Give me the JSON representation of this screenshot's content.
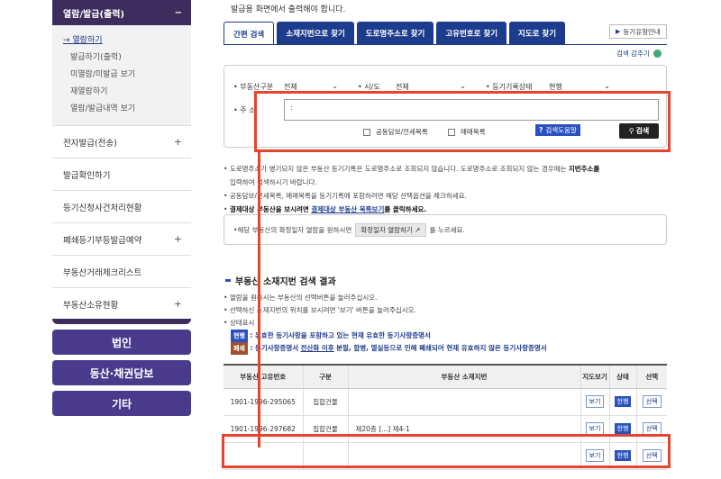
{
  "sidebar": {
    "header": "열람/발급(출력)",
    "header_icon": "minus-icon",
    "sub_items": [
      {
        "label": "열람하기",
        "active": true
      },
      {
        "label": "발급하기(출력)",
        "active": false
      },
      {
        "label": "미열람/미발급 보기",
        "active": false
      },
      {
        "label": "재열람하기",
        "active": false
      },
      {
        "label": "열람/발급내역 보기",
        "active": false
      }
    ],
    "items": [
      {
        "label": "전자발급(전송)",
        "plus": true
      },
      {
        "label": "발급확인하기",
        "plus": false
      },
      {
        "label": "등기신청사건처리현황",
        "plus": false
      },
      {
        "label": "폐쇄등기부등발급예약",
        "plus": true
      },
      {
        "label": "부동산거래체크리스트",
        "plus": false
      },
      {
        "label": "부동산소유현황",
        "plus": true
      }
    ],
    "plus_symbol": "+",
    "buttons": [
      "법인",
      "동산·채권담보",
      "기타"
    ]
  },
  "main": {
    "top_note": "발급용 화면에서 출력해야 합니다.",
    "tabs": [
      "간편 검색",
      "소재지번으로 찾기",
      "도로명주소로 찾기",
      "고유번호로 찾기",
      "지도로 찾기"
    ],
    "guide_button": "등기유형안내",
    "search_toggle": "검색 감추기",
    "search": {
      "type_label": "부동산구분",
      "type_value": "전체",
      "region_label": "시/도",
      "region_value": "전체",
      "status_label": "등기기록상태",
      "status_value": "현행",
      "address_label": "주 소",
      "address_value": ":",
      "check_collateral": "공동담보/전세목록",
      "check_trade": "매매목록",
      "help_button": "검색도움말",
      "search_button": "검색"
    },
    "notes": [
      "도로명주소가 병기되지 않은 부동산 등기기록은 도로명주소로 조회되지 않습니다. 도로명주소로 조회되지 않는 경우에는",
      "지번주소를",
      "입력하여 검색하시기 바랍니다.",
      "공동담보/전세목록, 매매목록을 등기기록에 포함하려면 해당 선택옵션을 체크하세요.",
      "결제대상 부동산을 보시려면",
      "결제대상 부동산 목록보기",
      "를 클릭하세요."
    ],
    "date_box": {
      "prefix": "해당 부동산의 확정일자 열람을 원하시면",
      "button": "확정일자 열람하기",
      "suffix": "를 누르세요."
    },
    "result_title": "부동산 소재지번 검색 결과",
    "result_notes": [
      "열람을 원하시는 부동산의 선택버튼을 눌러주십시오.",
      "선택하신 소재지번의 위치를 보시려면 '보기' 버튼을 눌러주십시오.",
      "상태표시"
    ],
    "legend": {
      "current_badge": "현행",
      "current_text": ": 유효한 등기사항을 포함하고 있는 현재 유효한 등기사항증명서",
      "closed_badge": "폐쇄",
      "closed_text_a": ": 등기사항증명서",
      "closed_highlight": "전산화 이후",
      "closed_text_b": "분필, 합병, 멸실등으로 인해 폐쇄되어 현재 유효하지 않은 등기사항증명서"
    },
    "table": {
      "headers": [
        "부동산 고유번호",
        "구분",
        "부동산 소재지번",
        "지도보기",
        "상태",
        "선택"
      ],
      "rows": [
        {
          "id": "1901-1996-295065",
          "type": "집합건물",
          "address": "",
          "view": "보기",
          "status": "현행",
          "select": "선택"
        },
        {
          "id": "1901-1996-297682",
          "type": "집합건물",
          "address": "제20층 [...] 제4-1",
          "view": "보기",
          "status": "현행",
          "select": "선택"
        },
        {
          "id": "",
          "type": "",
          "address": "",
          "view": "보기",
          "status": "현행",
          "select": "선택"
        }
      ]
    }
  },
  "colors": {
    "sidebar_dark": "#3d2d5c",
    "button_purple": "#4a3a8c",
    "tab_blue": "#1e3c8c",
    "annotation_red": "#e5452e"
  }
}
